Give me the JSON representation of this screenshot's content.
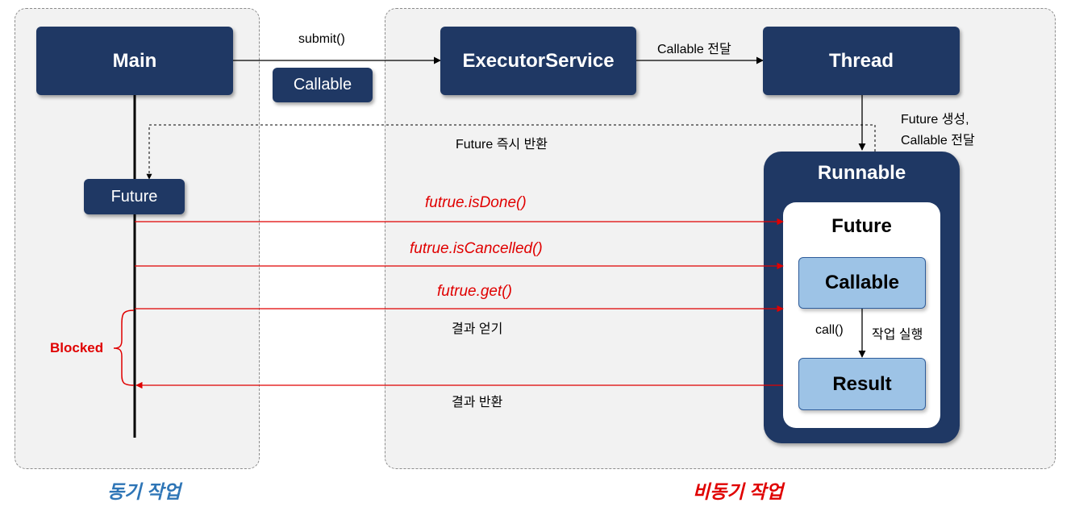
{
  "sync": {
    "caption": "동기 작업",
    "main": "Main",
    "future": "Future",
    "blocked": "Blocked"
  },
  "async": {
    "caption": "비동기 작업",
    "executor": "ExecutorService",
    "thread": "Thread",
    "runnable": "Runnable",
    "future": "Future",
    "callable": "Callable",
    "result": "Result"
  },
  "labels": {
    "submit": "submit()",
    "callable_param": "Callable",
    "callable_pass": "Callable 전달",
    "future_create_1": "Future 생성,",
    "future_create_2": "Callable 전달",
    "future_return": "Future 즉시 반환",
    "is_done": "futrue.isDone()",
    "is_cancelled": "futrue.isCancelled()",
    "get": "futrue.get()",
    "get_result": "결과 얻기",
    "return_result": "결과 반환",
    "call": "call()",
    "run_task": "작업 실행"
  },
  "colors": {
    "navy": "#1f3864",
    "light_blue": "#9dc3e6",
    "red": "#e00000",
    "caption_blue": "#2e75b6"
  }
}
